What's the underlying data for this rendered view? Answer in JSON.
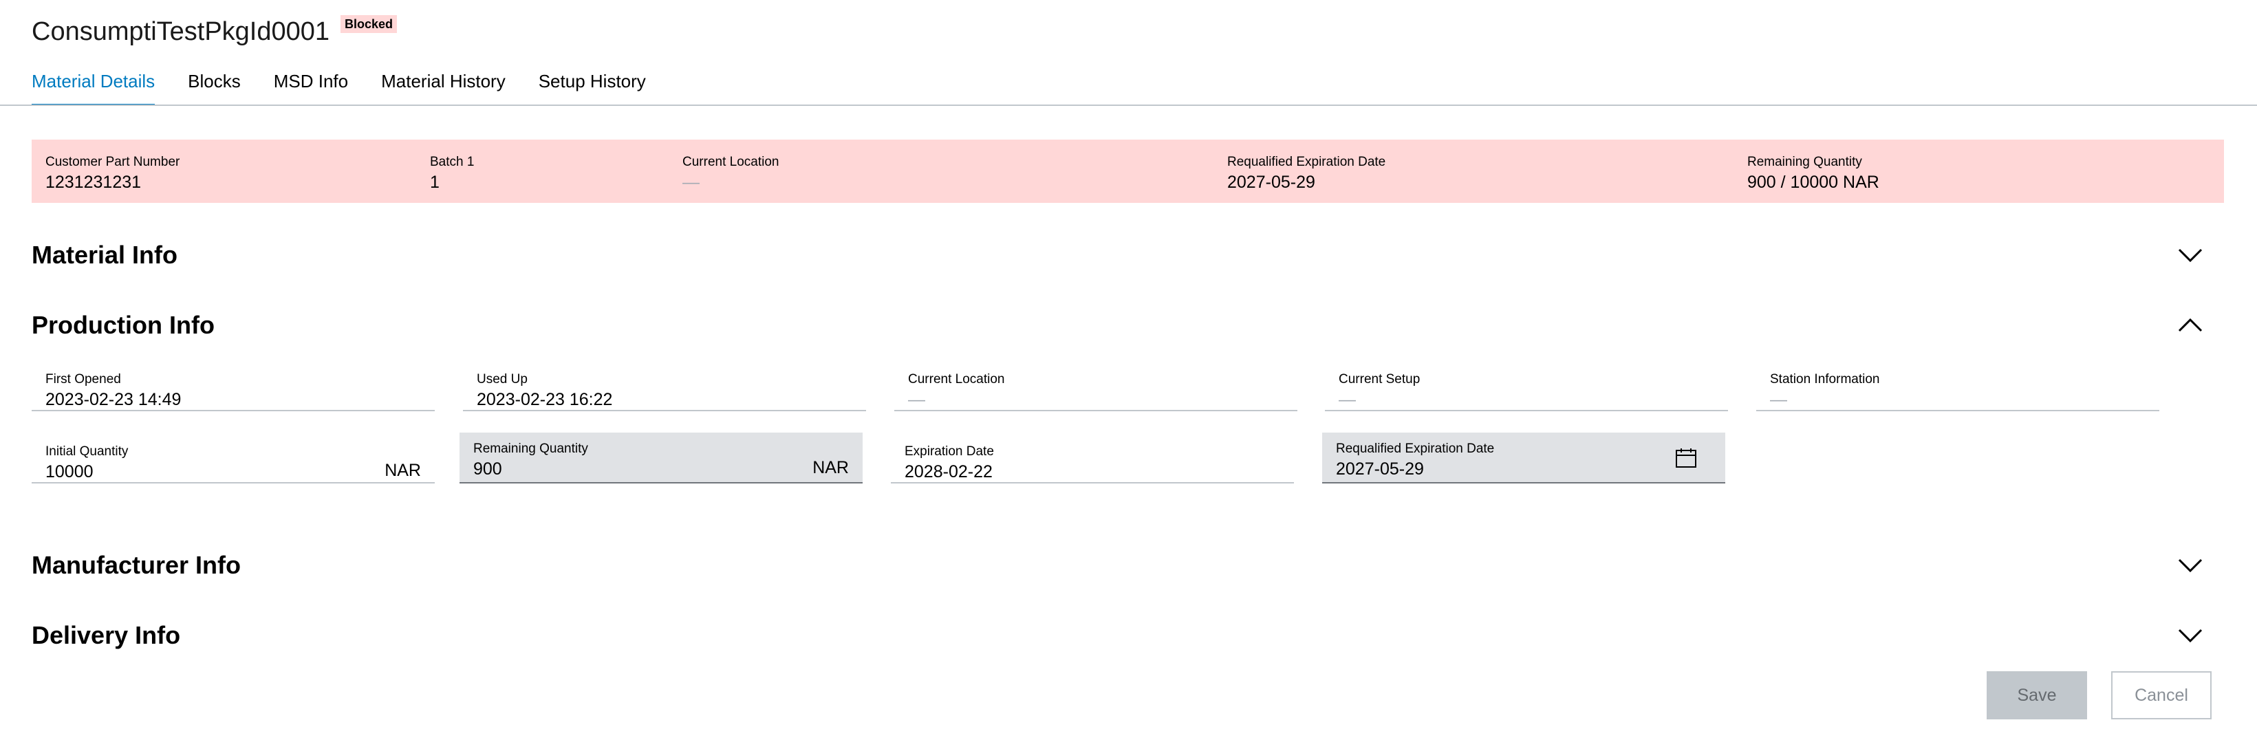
{
  "header": {
    "title": "ConsumptiTestPkgId0001",
    "badge": "Blocked"
  },
  "tabs": [
    {
      "label": "Material Details",
      "active": true
    },
    {
      "label": "Blocks"
    },
    {
      "label": "MSD Info"
    },
    {
      "label": "Material History"
    },
    {
      "label": "Setup History"
    }
  ],
  "summary": {
    "customer_part_number": {
      "label": "Customer Part Number",
      "value": "1231231231"
    },
    "batch": {
      "label": "Batch 1",
      "value": "1"
    },
    "current_location": {
      "label": "Current Location",
      "value": "—"
    },
    "requalified_expiration": {
      "label": "Requalified Expiration Date",
      "value": "2027-05-29"
    },
    "remaining_quantity": {
      "label": "Remaining Quantity",
      "value": "900 / 10000 NAR"
    }
  },
  "sections": {
    "material_info": {
      "title": "Material Info",
      "expanded": false
    },
    "production_info": {
      "title": "Production Info",
      "expanded": true
    },
    "manufacturer_info": {
      "title": "Manufacturer Info",
      "expanded": false
    },
    "delivery_info": {
      "title": "Delivery Info",
      "expanded": false
    }
  },
  "production": {
    "first_opened": {
      "label": "First Opened",
      "value": "2023-02-23 14:49"
    },
    "used_up": {
      "label": "Used Up",
      "value": "2023-02-23 16:22"
    },
    "current_location": {
      "label": "Current Location",
      "value": "—"
    },
    "current_setup": {
      "label": "Current Setup",
      "value": "—"
    },
    "station_information": {
      "label": "Station Information",
      "value": "—"
    },
    "initial_quantity": {
      "label": "Initial Quantity",
      "value": "10000",
      "unit": "NAR"
    },
    "remaining_quantity": {
      "label": "Remaining Quantity",
      "value": "900",
      "unit": "NAR"
    },
    "expiration_date": {
      "label": "Expiration Date",
      "value": "2028-02-22"
    },
    "requalified_expiration_date": {
      "label": "Requalified Expiration Date",
      "value": "2027-05-29"
    }
  },
  "buttons": {
    "save": "Save",
    "cancel": "Cancel"
  },
  "colors": {
    "accent": "#007bc0",
    "blocked_bg": "#ffd7d7",
    "field_grey": "#e0e2e5"
  },
  "icons": {
    "collapsed": "chevron-down-icon",
    "expanded": "chevron-up-icon",
    "date": "calendar-icon"
  }
}
